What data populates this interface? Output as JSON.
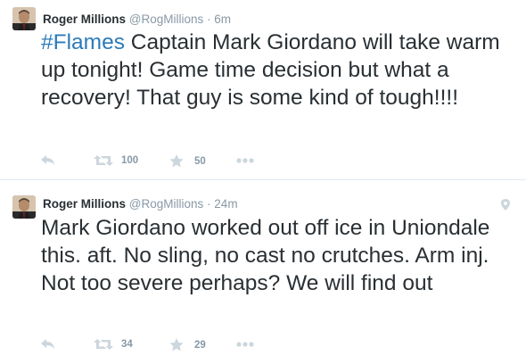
{
  "tweets": [
    {
      "user": {
        "name": "Roger Millions",
        "handle": "@RogMillions"
      },
      "separator": "·",
      "time": "6m",
      "hashtag": "#Flames",
      "text": " Captain Mark Giordano will take warm up tonight! Game time decision but what a recovery! That guy is some kind of tough!!!!",
      "retweets": "100",
      "favorites": "50",
      "has_location": false
    },
    {
      "user": {
        "name": "Roger Millions",
        "handle": "@RogMillions"
      },
      "separator": "·",
      "time": "24m",
      "hashtag": "",
      "text": "Mark Giordano worked out off ice in Uniondale this. aft. No sling, no cast no crutches. Arm inj. Not too severe perhaps? We will find out",
      "retweets": "34",
      "favorites": "29",
      "has_location": true
    }
  ],
  "icons": {
    "reply": "reply-icon",
    "retweet": "retweet-icon",
    "favorite": "star-icon",
    "more": "more-icon",
    "location": "location-pin-icon"
  },
  "colors": {
    "hashtag": "#2b7bb9",
    "muted": "#8899a6",
    "text": "#292f33"
  }
}
